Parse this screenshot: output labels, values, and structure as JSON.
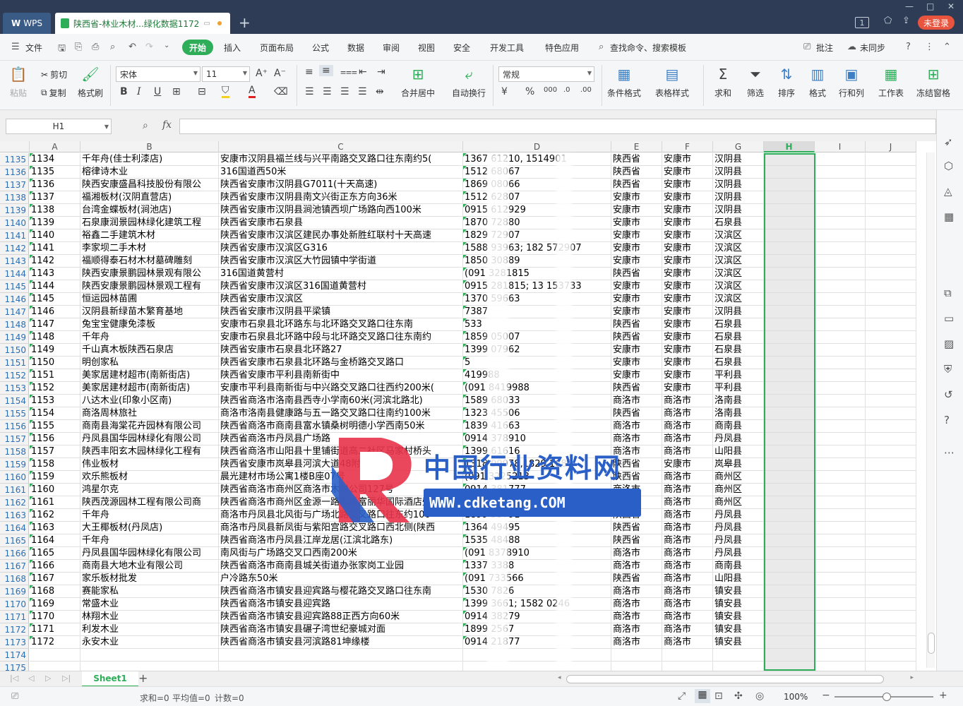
{
  "titlebar": {
    "app_tab": "WPS",
    "doc_tab": "陕西省-林业木材...绿化数据1172",
    "login": "未登录",
    "page_badge": "1"
  },
  "menubar": {
    "file": "文件",
    "start": "开始",
    "items": [
      "插入",
      "页面布局",
      "公式",
      "数据",
      "审阅",
      "视图",
      "安全",
      "开发工具",
      "特色应用"
    ],
    "search": "查找命令、搜索模板",
    "annotate": "批注",
    "sync": "未同步"
  },
  "ribbon": {
    "paste": "粘贴",
    "cut": "剪切",
    "copy": "复制",
    "format_painter": "格式刷",
    "font_name": "宋体",
    "font_size": "11",
    "merge_center": "合并居中",
    "wrap_text": "自动换行",
    "number_format": "常规",
    "conditional_format": "条件格式",
    "table_style": "表格样式",
    "sum": "求和",
    "filter": "筛选",
    "sort": "排序",
    "format": "格式",
    "rows_cols": "行和列",
    "worksheet": "工作表",
    "freeze": "冻结窗格"
  },
  "formula_bar": {
    "name_box": "H1",
    "fx": "fx"
  },
  "columns": [
    "A",
    "B",
    "C",
    "D",
    "E",
    "F",
    "G",
    "H",
    "I",
    "J"
  ],
  "rows": [
    {
      "n": "1135",
      "a": "1134",
      "b": "千年舟(佳士利漆店)",
      "c": "安康市汉阴县福兰线与兴平南路交叉路口往东南约5(",
      "d": "1367      61210,       1514901",
      "e": "陕西省",
      "f": "安康市",
      "g": "汉阴县"
    },
    {
      "n": "1136",
      "a": "1135",
      "b": "榕律诗木业",
      "c": "316国道西50米",
      "d": "1512      68067",
      "e": "陕西省",
      "f": "安康市",
      "g": "汉阴县"
    },
    {
      "n": "1137",
      "a": "1136",
      "b": "陕西安康盛昌科技股份有限公",
      "c": "陕西省安康市汉阴县G7011(十天高速)",
      "d": "1869      08066",
      "e": "陕西省",
      "f": "安康市",
      "g": "汉阴县"
    },
    {
      "n": "1138",
      "a": "1137",
      "b": "福湘板材(汉阴直营店)",
      "c": "陕西省安康市汉阴县南文兴街正东方向36米",
      "d": "1512      62807",
      "e": "安康市",
      "f": "安康市",
      "g": "汉阴县"
    },
    {
      "n": "1139",
      "a": "1138",
      "b": "台湾金蝶板材(涧池店)",
      "c": "陕西省安康市汉阴县涧池镇西坝广场路向西100米",
      "d": "0915      612929",
      "e": "安康市",
      "f": "安康市",
      "g": "汉阴县"
    },
    {
      "n": "1140",
      "a": "1139",
      "b": "石泉康润景园林绿化建筑工程",
      "c": "陕西省安康市石泉县",
      "d": "1870      72880",
      "e": "安康市",
      "f": "安康市",
      "g": "石泉县"
    },
    {
      "n": "1141",
      "a": "1140",
      "b": "裕鑫二手建筑木材",
      "c": "陕西省安康市汉滨区建民办事处新胜红联村十天高速",
      "d": "1829      72907",
      "e": "安康市",
      "f": "安康市",
      "g": "汉滨区"
    },
    {
      "n": "1142",
      "a": "1141",
      "b": "李家坝二手木材",
      "c": "陕西省安康市汉滨区G316",
      "d": "1588      93963; 182      572907",
      "e": "安康市",
      "f": "安康市",
      "g": "汉滨区"
    },
    {
      "n": "1143",
      "a": "1142",
      "b": "福顺得泰石材木材墓碑雕刻",
      "c": "陕西省安康市汉滨区大竹园镇中学街道",
      "d": "1850      30889",
      "e": "安康市",
      "f": "安康市",
      "g": "汉滨区"
    },
    {
      "n": "1144",
      "a": "1143",
      "b": "陕西安康景鹏园林景观有限公",
      "c": "316国道黄营村",
      "d": "(091      3281815",
      "e": "陕西省",
      "f": "安康市",
      "g": "汉滨区"
    },
    {
      "n": "1145",
      "a": "1144",
      "b": "陕西安康景鹏园林景观工程有",
      "c": "陕西省安康市汉滨区316国道黄营村",
      "d": "0915      281815; 13      153733",
      "e": "安康市",
      "f": "安康市",
      "g": "汉滨区"
    },
    {
      "n": "1146",
      "a": "1145",
      "b": "恒运园林苗圃",
      "c": "陕西省安康市汉滨区",
      "d": "1370      59663",
      "e": "安康市",
      "f": "安康市",
      "g": "汉滨区"
    },
    {
      "n": "1147",
      "a": "1146",
      "b": "汉阴县新绿苗木繁育基地",
      "c": "陕西省安康市汉阴县平梁镇",
      "d": "      7387",
      "e": "安康市",
      "f": "安康市",
      "g": "汉阴县"
    },
    {
      "n": "1148",
      "a": "1147",
      "b": "兔宝宝健康免漆板",
      "c": "安康市石泉县北环路东与北环路交叉路口往东南",
      "d": "      533",
      "e": "陕西省",
      "f": "安康市",
      "g": "石泉县"
    },
    {
      "n": "1149",
      "a": "1148",
      "b": "千年舟",
      "c": "安康市石泉县北环路中段与北环路交叉路口往东南约",
      "d": "1859      05007",
      "e": "陕西省",
      "f": "安康市",
      "g": "石泉县"
    },
    {
      "n": "1150",
      "a": "1149",
      "b": "千山真木板陕西石泉店",
      "c": "陕西省安康市石泉县北环路27",
      "d": "1399      07962",
      "e": "安康市",
      "f": "安康市",
      "g": "石泉县"
    },
    {
      "n": "1151",
      "a": "1150",
      "b": "明创家私",
      "c": "陕西省安康市石泉县北环路与金桥路交叉路口",
      "d": "      5",
      "e": "安康市",
      "f": "安康市",
      "g": "石泉县"
    },
    {
      "n": "1152",
      "a": "1151",
      "b": "美家居建材超市(南新街店)",
      "c": "陕西省安康市平利县南新街中",
      "d": "      419988",
      "e": "安康市",
      "f": "安康市",
      "g": "平利县"
    },
    {
      "n": "1153",
      "a": "1152",
      "b": "美家居建材超市(南新街店)",
      "c": "安康市平利县南新街与中兴路交叉路口往西约200米(",
      "d": "(091      8419988",
      "e": "陕西省",
      "f": "安康市",
      "g": "平利县"
    },
    {
      "n": "1154",
      "a": "1153",
      "b": "八达木业(印象小区南)",
      "c": "陕西省商洛市洛南县西寺小学南60米(河滨北路北)",
      "d": "1589      68033",
      "e": "商洛市",
      "f": "商洛市",
      "g": "洛南县"
    },
    {
      "n": "1155",
      "a": "1154",
      "b": "商洛周林旅社",
      "c": "商洛市洛南县健康路与五一路交叉路口往南约100米",
      "d": "1323      45506",
      "e": "陕西省",
      "f": "商洛市",
      "g": "洛南县"
    },
    {
      "n": "1156",
      "a": "1155",
      "b": "商南县海棠花卉园林有限公司",
      "c": "陕西省商洛市商南县富水镇桑树明德小学西南50米",
      "d": "1839      41663",
      "e": "商洛市",
      "f": "商洛市",
      "g": "商南县"
    },
    {
      "n": "1157",
      "a": "1156",
      "b": "丹凤县国华园林绿化有限公司",
      "c": "陕西省商洛市丹凤县广场路",
      "d": "0914      378910",
      "e": "商洛市",
      "f": "商洛市",
      "g": "丹凤县"
    },
    {
      "n": "1158",
      "a": "1157",
      "b": "陕西丰阳玄木园林绿化工程有",
      "c": "陕西省商洛市山阳县十里铺街道高二社区马家村桥头",
      "d": "1399      61616",
      "e": "商洛市",
      "f": "商洛市",
      "g": "山阳县"
    },
    {
      "n": "1159",
      "a": "1158",
      "b": "伟业板材",
      "c": "陕西省安康市岚皋县河滨大道48附近",
      "d": "1318      99978,1829      1687",
      "e": "陕西省",
      "f": "安康市",
      "g": "岚皋县"
    },
    {
      "n": "1160",
      "a": "1159",
      "b": "欢乐熊板材",
      "c": "晨光建材市场公寓1楼B座07号",
      "d": "(091      3225213",
      "e": "陕西省",
      "f": "商洛市",
      "g": "商州区"
    },
    {
      "n": "1161",
      "a": "1160",
      "b": "鸿星尔克",
      "c": "陕西省商洛市商州区商洛市木材公司127号",
      "d": "0914      381777",
      "e": "商洛市",
      "f": "商洛市",
      "g": "商州区"
    },
    {
      "n": "1162",
      "a": "1161",
      "b": "陕西茂源园林工程有限公司商",
      "c": "陕西省商洛市商州区金源一路南段富丽华国际酒店旁",
      "d": "0914      330699",
      "e": "商洛市",
      "f": "商洛市",
      "g": "商州区"
    },
    {
      "n": "1163",
      "a": "1162",
      "b": "千年舟",
      "c": "商洛市丹凤县北风街与广场北路交叉路口往东约100",
      "d": "1899      53791",
      "e": "陕西省",
      "f": "商洛市",
      "g": "丹凤县"
    },
    {
      "n": "1164",
      "a": "1163",
      "b": "大王椰板材(丹凤店)",
      "c": "商洛市丹凤县新凤街与紫阳宫路交叉路口西北侧(陕西",
      "d": "1364      49495",
      "e": "陕西省",
      "f": "商洛市",
      "g": "丹凤县"
    },
    {
      "n": "1165",
      "a": "1164",
      "b": "千年舟",
      "c": "陕西省商洛市丹凤县江岸龙居(江滨北路东)",
      "d": "1535      48488",
      "e": "陕西省",
      "f": "商洛市",
      "g": "丹凤县"
    },
    {
      "n": "1166",
      "a": "1165",
      "b": "丹凤县国华园林绿化有限公司",
      "c": "南风街与广场路交叉口西南200米",
      "d": "(091      8378910",
      "e": "商洛市",
      "f": "商洛市",
      "g": "丹凤县"
    },
    {
      "n": "1167",
      "a": "1166",
      "b": "商南县大地木业有限公司",
      "c": "陕西省商洛市商南县城关街道办张家岗工业园",
      "d": "1337      3388",
      "e": "商洛市",
      "f": "商洛市",
      "g": "商南县"
    },
    {
      "n": "1168",
      "a": "1167",
      "b": "家乐板材批发",
      "c": "户冷路东50米",
      "d": "(091      733566",
      "e": "陕西省",
      "f": "商洛市",
      "g": "山阳县"
    },
    {
      "n": "1169",
      "a": "1168",
      "b": "赛能家私",
      "c": "陕西省商洛市镇安县迎宾路与樱花路交叉路口往东南",
      "d": "1530      7826",
      "e": "商洛市",
      "f": "商洛市",
      "g": "镇安县"
    },
    {
      "n": "1170",
      "a": "1169",
      "b": "常盛木业",
      "c": "陕西省商洛市镇安县迎宾路",
      "d": "1399      3661; 1582      0246",
      "e": "商洛市",
      "f": "商洛市",
      "g": "镇安县"
    },
    {
      "n": "1171",
      "a": "1170",
      "b": "林翔木业",
      "c": "陕西省商洛市镇安县迎宾路88正西方向60米",
      "d": "0914      38279",
      "e": "商洛市",
      "f": "商洛市",
      "g": "镇安县"
    },
    {
      "n": "1172",
      "a": "1171",
      "b": "利发木业",
      "c": "陕西省商洛市镇安县碾子湾世纪豪城对面",
      "d": "1899      2567",
      "e": "商洛市",
      "f": "商洛市",
      "g": "镇安县"
    },
    {
      "n": "1173",
      "a": "1172",
      "b": "永安木业",
      "c": "陕西省商洛市镇安县河滨路81坤缘楼",
      "d": "0914      21877",
      "e": "商洛市",
      "f": "商洛市",
      "g": "镇安县"
    },
    {
      "n": "1174",
      "a": "",
      "b": "",
      "c": "",
      "d": "",
      "e": "",
      "f": "",
      "g": ""
    },
    {
      "n": "1175",
      "a": "",
      "b": "",
      "c": "",
      "d": "",
      "e": "",
      "f": "",
      "g": ""
    }
  ],
  "watermark": {
    "title": "中国行业资料网",
    "url": "WWW.cdketang.COM"
  },
  "sheets": {
    "active": "Sheet1"
  },
  "status": {
    "sum": "求和=0",
    "avg": "平均值=0",
    "count": "计数=0",
    "zoom": "100%"
  },
  "colors": {
    "accent": "#2fae5a",
    "titlebar": "#2e3d55",
    "selection": "#2fae5a"
  }
}
